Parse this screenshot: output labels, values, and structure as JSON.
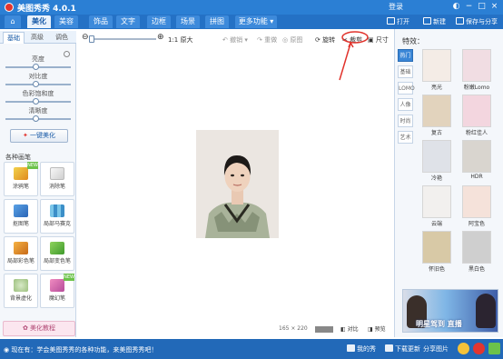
{
  "app": {
    "title": "美图秀秀 4.0.1",
    "login": "登录"
  },
  "navbar": {
    "tabs": [
      "美化",
      "美容",
      "饰品",
      "文字",
      "边框",
      "场景",
      "拼图"
    ],
    "more": "更多功能",
    "open_label": "打开",
    "new_label": "新建",
    "save_label": "保存与分享"
  },
  "left_panel": {
    "subtabs": [
      "基础",
      "高级",
      "调色"
    ],
    "sliders": [
      {
        "label": "亮度",
        "level": 0.45
      },
      {
        "label": "对比度",
        "level": 0.45
      },
      {
        "label": "色彩饱和度",
        "level": 0.45
      },
      {
        "label": "清晰度",
        "level": 0.45
      }
    ],
    "one_click": "一键美化",
    "section_title": "各种画笔",
    "tools": [
      {
        "label": "涂鸦笔",
        "badge": ""
      },
      {
        "label": "消除笔",
        "badge": ""
      },
      {
        "label": "抠图笔",
        "badge": ""
      },
      {
        "label": "局部马赛克",
        "badge": ""
      },
      {
        "label": "局部彩色笔",
        "badge": ""
      },
      {
        "label": "局部变色笔",
        "badge": ""
      },
      {
        "label": "背景虚化",
        "badge": ""
      },
      {
        "label": "魔幻笔",
        "badge": ""
      }
    ],
    "bottom_button": "美化教程"
  },
  "canvas": {
    "zoom_text": "1:1 原大",
    "tools": [
      "撤销",
      "重做",
      "原图",
      "旋转",
      "裁剪",
      "尺寸"
    ],
    "size_readout": "165 × 220",
    "ratio_badge": "",
    "compare_label": "对比",
    "preview_label": "预览"
  },
  "right_panel": {
    "title": "特效：",
    "categories": [
      "热门",
      "基础",
      "LOMO",
      "人像",
      "时尚",
      "艺术"
    ],
    "effects": [
      "亮光",
      "粉嫩Lomo",
      "复古",
      "粉红佳人",
      "冷艳",
      "HDR",
      "云端",
      "阿宝色",
      "怀旧色",
      "黑白色"
    ],
    "ad_text": "明星驾到 直播"
  },
  "footer": {
    "tip": "现在有：学会美图秀秀的各种功能，来美图秀秀吧！",
    "items": [
      "我的秀",
      "下载更新",
      "分享图片"
    ]
  },
  "colors": {
    "brand_blue": "#2b7fd4",
    "accent_red": "#e2352f"
  }
}
